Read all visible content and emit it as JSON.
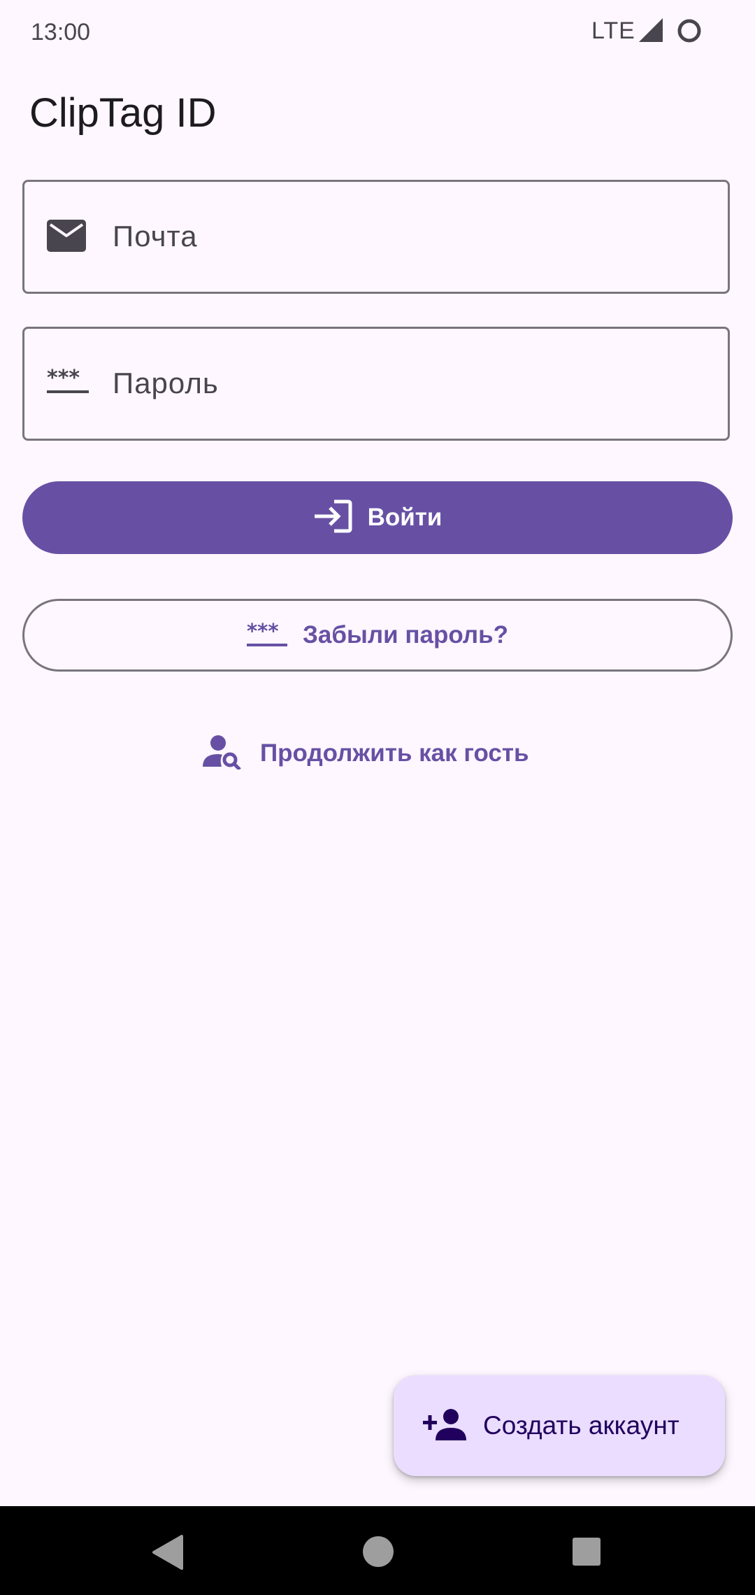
{
  "status_bar": {
    "time": "13:00",
    "network": "LTE",
    "icons": [
      "signal-icon",
      "battery-icon"
    ]
  },
  "app": {
    "title": "ClipTag ID"
  },
  "form": {
    "email_placeholder": "Почта",
    "password_placeholder": "Пароль",
    "login_label": "Войти",
    "forgot_password_label": "Забыли пароль?",
    "guest_label": "Продолжить как гость",
    "create_account_label": "Создать аккаунт",
    "icons": {
      "email": "mail-icon",
      "password": "password-icon",
      "login": "login-icon",
      "forgot": "password-icon",
      "guest": "person-search-icon",
      "create": "person-add-icon"
    }
  },
  "navigation_bar": {
    "buttons": [
      "back",
      "home",
      "recents"
    ]
  },
  "colors": {
    "primary": "#6750A4",
    "background": "#FEF7FF",
    "fab_container": "#EADDFF",
    "fab_content": "#21005D",
    "outline": "#79747E"
  }
}
